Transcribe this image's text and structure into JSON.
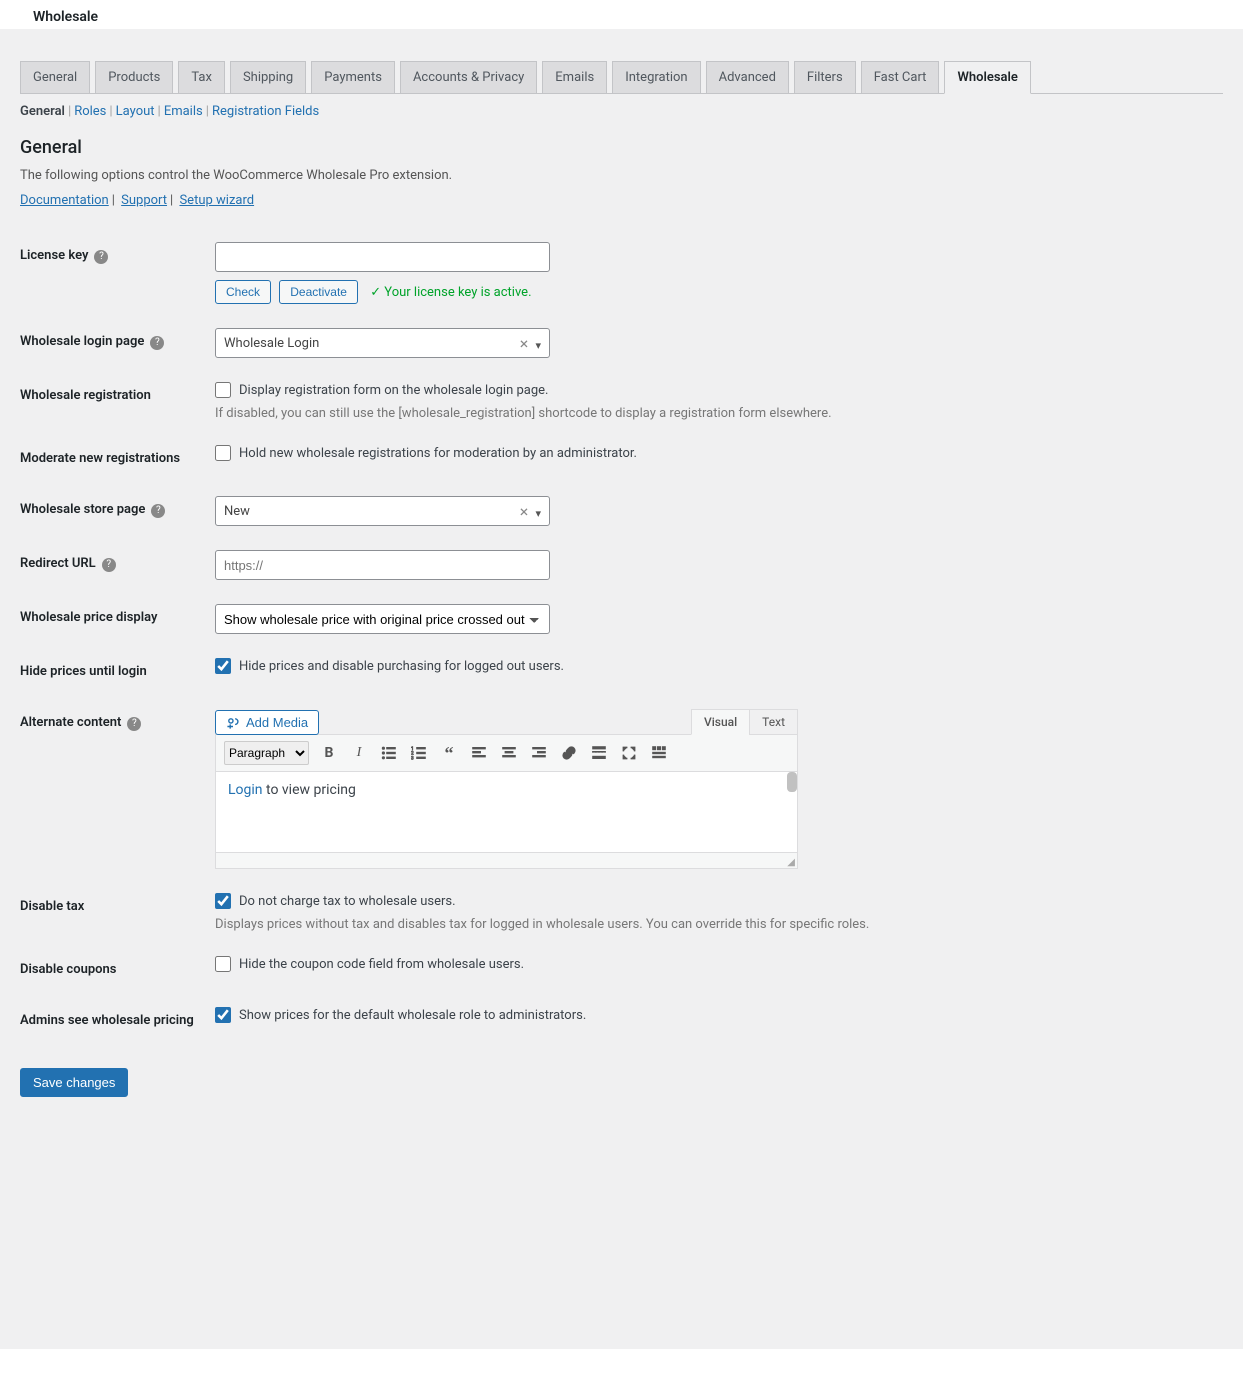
{
  "page_title": "Wholesale",
  "main_tabs": [
    "General",
    "Products",
    "Tax",
    "Shipping",
    "Payments",
    "Accounts & Privacy",
    "Emails",
    "Integration",
    "Advanced",
    "Filters",
    "Fast Cart",
    "Wholesale"
  ],
  "active_main_tab": 11,
  "sub_tabs": [
    "General",
    "Roles",
    "Layout",
    "Emails",
    "Registration Fields"
  ],
  "active_sub_tab": 0,
  "section_heading": "General",
  "section_desc": "The following options control the WooCommerce Wholesale Pro extension.",
  "doc_links": {
    "documentation": "Documentation",
    "support": "Support",
    "setup": "Setup wizard"
  },
  "fields": {
    "license_key": {
      "label": "License key",
      "value": "",
      "check": "Check",
      "deactivate": "Deactivate",
      "status": "✓ Your license key is active."
    },
    "login_page": {
      "label": "Wholesale login page",
      "value": "Wholesale Login"
    },
    "registration": {
      "label": "Wholesale registration",
      "checkbox_label": "Display registration form on the wholesale login page.",
      "help": "If disabled, you can still use the [wholesale_registration] shortcode to display a registration form elsewhere.",
      "checked": false
    },
    "moderate": {
      "label": "Moderate new registrations",
      "checkbox_label": "Hold new wholesale registrations for moderation by an administrator.",
      "checked": false
    },
    "store_page": {
      "label": "Wholesale store page",
      "value": "New"
    },
    "redirect": {
      "label": "Redirect URL",
      "placeholder": "https://"
    },
    "price_display": {
      "label": "Wholesale price display",
      "value": "Show wholesale price with original price crossed out"
    },
    "hide_prices": {
      "label": "Hide prices until login",
      "checkbox_label": "Hide prices and disable purchasing for logged out users.",
      "checked": true
    },
    "alt_content": {
      "label": "Alternate content",
      "add_media": "Add Media",
      "visual_tab": "Visual",
      "text_tab": "Text",
      "para": "Paragraph",
      "link_text": "Login",
      "rest_text": " to view pricing"
    },
    "disable_tax": {
      "label": "Disable tax",
      "checkbox_label": "Do not charge tax to wholesale users.",
      "help": "Displays prices without tax and disables tax for logged in wholesale users. You can override this for specific roles.",
      "checked": true
    },
    "disable_coupons": {
      "label": "Disable coupons",
      "checkbox_label": "Hide the coupon code field from wholesale users.",
      "checked": false
    },
    "admin_pricing": {
      "label": "Admins see wholesale pricing",
      "checkbox_label": "Show prices for the default wholesale role to administrators.",
      "checked": true
    }
  },
  "save_button": "Save changes"
}
